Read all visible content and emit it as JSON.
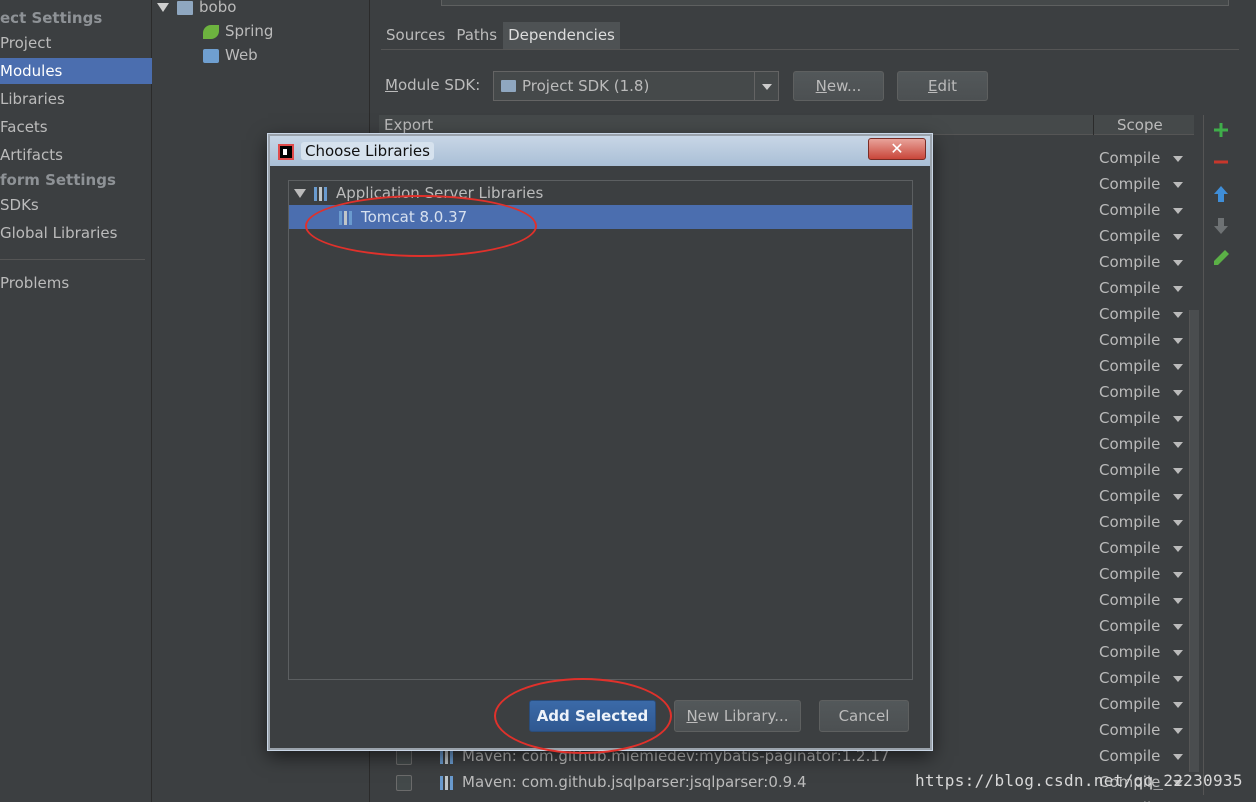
{
  "sidebar": {
    "project_settings_heading": "ect Settings",
    "items_top": [
      {
        "label": "Project",
        "selected": false
      },
      {
        "label": "Modules",
        "selected": true
      },
      {
        "label": "Libraries",
        "selected": false
      },
      {
        "label": "Facets",
        "selected": false
      },
      {
        "label": "Artifacts",
        "selected": false
      }
    ],
    "platform_settings_heading": "form Settings",
    "items_platform": [
      {
        "label": "SDKs"
      },
      {
        "label": "Global Libraries"
      }
    ],
    "problems_label": "Problems"
  },
  "module_tree": {
    "root": "bobo",
    "children": [
      "Spring",
      "Web"
    ]
  },
  "module_pane": {
    "tabs": [
      {
        "label": "Sources",
        "active": false
      },
      {
        "label": "Paths",
        "active": false
      },
      {
        "label": "Dependencies",
        "active": true
      }
    ],
    "sdk_label_underline": "M",
    "sdk_label_rest": "odule SDK:",
    "sdk_value": "Project SDK (1.8)",
    "new_button_underline": "N",
    "new_button_rest": "ew...",
    "edit_button_underline": "E",
    "edit_button_rest": "dit",
    "table_headers": {
      "export": "Export",
      "scope": "Scope"
    },
    "scope_value": "Compile",
    "bottom_rows": [
      {
        "label": "Maven: com.github.miemiedev:mybatis-paginator:1.2.17"
      },
      {
        "label": "Maven: com.github.jsqlparser:jsqlparser:0.9.4"
      }
    ],
    "tool_colors": {
      "add": "#3fae4a",
      "remove": "#c7372c",
      "up": "#3f8ed8",
      "down": "#6e7274",
      "edit": "#5bb046"
    }
  },
  "dialog": {
    "title": "Choose Libraries",
    "close_glyph": "✕",
    "tree": {
      "group": "Application Server Libraries",
      "item": "Tomcat 8.0.37"
    },
    "buttons": {
      "add_selected": "Add Selected",
      "new_library_underline": "N",
      "new_library_rest": "ew Library...",
      "cancel": "Cancel"
    }
  },
  "watermark": "https://blog.csdn.net/qq_22230935",
  "annotation_color": "#e0312b"
}
